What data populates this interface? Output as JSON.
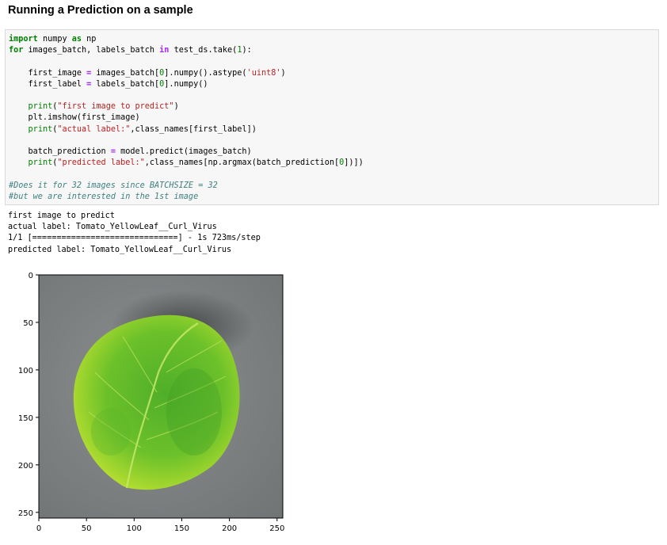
{
  "heading": "Running a Prediction on a sample",
  "code": {
    "line1": [
      "import",
      " numpy ",
      "as",
      " np"
    ],
    "line2": [
      "for",
      " images_batch, labels_batch ",
      "in",
      " test_ds.take(",
      "1",
      "):"
    ],
    "line4": [
      "    first_image ",
      "=",
      " images_batch[",
      "0",
      "].numpy().astype(",
      "'uint8'",
      ")"
    ],
    "line5": [
      "    first_label ",
      "=",
      " labels_batch[",
      "0",
      "].numpy()"
    ],
    "line7": [
      "    ",
      "print",
      "(",
      "\"first image to predict\"",
      ")"
    ],
    "line8": [
      "    plt.imshow(first_image)"
    ],
    "line9": [
      "    ",
      "print",
      "(",
      "\"actual label:\"",
      ",class_names[first_label])"
    ],
    "line11": [
      "    batch_prediction ",
      "=",
      " model.predict(images_batch)"
    ],
    "line12": [
      "    ",
      "print",
      "(",
      "\"predicted label:\"",
      ",class_names[np.argmax(batch_prediction[",
      "0",
      "])])"
    ],
    "line14": [
      "#Does it for 32 images since BATCHSIZE = 32"
    ],
    "line15": [
      "#but we are interested in the 1st image"
    ]
  },
  "output": [
    "first image to predict",
    "actual label: Tomato_YellowLeaf__Curl_Virus",
    "1/1 [==============================] - 1s 723ms/step",
    "predicted label: Tomato_YellowLeaf__Curl_Virus"
  ],
  "plot": {
    "x_ticks": [
      "0",
      "50",
      "100",
      "150",
      "200",
      "250"
    ],
    "y_ticks": [
      "0",
      "50",
      "100",
      "150",
      "200",
      "250"
    ],
    "x_range": [
      0,
      256
    ],
    "y_range": [
      0,
      256
    ],
    "image_subject": "leaf-image",
    "colors": {
      "background": "#7d8182",
      "leaf_light": "#d6ec3a",
      "leaf_mid": "#8fd12a",
      "leaf_dark": "#4fae29",
      "vein": "#c8e86a"
    }
  }
}
